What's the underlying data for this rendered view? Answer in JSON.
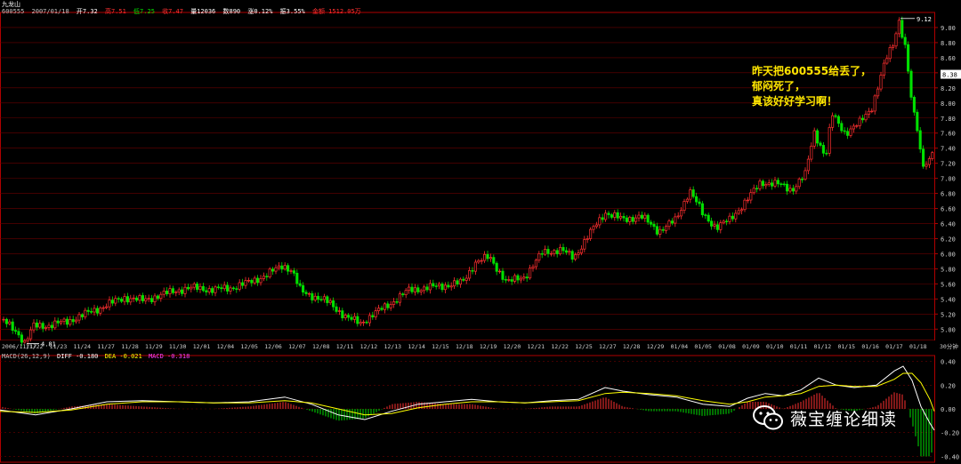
{
  "header": {
    "name": "九龙山",
    "code": "600555",
    "date": "2007/01/18",
    "open": "开7.32",
    "high": "高7.51",
    "low": "低7.25",
    "close": "收7.47",
    "volume": "量12036",
    "count": "数890",
    "change": "涨0.12%",
    "turnover": "振3.55%",
    "amount": "金额 1512.05万"
  },
  "annotation": {
    "line1": "昨天把600555给丢了，",
    "line2": "郁闷死了，",
    "line3": "真该好好学习啊！"
  },
  "macd_label": {
    "params": "MACD(26,12,9)",
    "diff": "DIFF -0.180",
    "dea": "DEA -0.021",
    "macd": "MACD -0.318"
  },
  "watermark": "薇宝缠论细读",
  "colors": {
    "up": "#ff3030",
    "down": "#00e000",
    "grid": "#6a0000",
    "axis": "#b00000",
    "diff_line": "#ffffff",
    "dea_line": "#ffff00",
    "note_text": "#ffe600",
    "current_price_bg": "#ffffff"
  },
  "chart_data": {
    "type": "candlestick",
    "price_axis": {
      "ticks": [
        "9.00",
        "8.80",
        "8.60",
        "8.40",
        "8.20",
        "8.00",
        "7.80",
        "7.60",
        "7.40",
        "7.20",
        "7.00",
        "6.80",
        "6.60",
        "6.40",
        "6.20",
        "6.00",
        "5.80",
        "5.60",
        "5.40",
        "5.20",
        "5.00"
      ],
      "ylim": [
        4.85,
        9.2
      ]
    },
    "current_price": "8.38",
    "max_label": "9.12",
    "min_label": "4.81",
    "x_ticks": [
      "2006/11/17",
      "11/22",
      "11/23",
      "11/24",
      "11/27",
      "11/28",
      "11/29",
      "11/30",
      "12/01",
      "12/04",
      "12/05",
      "12/06",
      "12/07",
      "12/08",
      "12/11",
      "12/12",
      "12/13",
      "12/14",
      "12/15",
      "12/18",
      "12/19",
      "12/20",
      "12/21",
      "12/22",
      "12/25",
      "12/27",
      "12/28",
      "12/29",
      "01/04",
      "01/05",
      "01/08",
      "01/09",
      "01/10",
      "01/11",
      "01/12",
      "01/15",
      "01/16",
      "01/17",
      "01/18"
    ],
    "x_unit": "30分钟",
    "close_path": [
      [
        0,
        5.14
      ],
      [
        10,
        5.05
      ],
      [
        20,
        4.95
      ],
      [
        28,
        4.82
      ],
      [
        38,
        5.04
      ],
      [
        55,
        5.05
      ],
      [
        75,
        5.1
      ],
      [
        100,
        5.22
      ],
      [
        120,
        5.32
      ],
      [
        140,
        5.42
      ],
      [
        160,
        5.38
      ],
      [
        180,
        5.45
      ],
      [
        200,
        5.52
      ],
      [
        220,
        5.55
      ],
      [
        240,
        5.52
      ],
      [
        260,
        5.55
      ],
      [
        280,
        5.62
      ],
      [
        300,
        5.72
      ],
      [
        318,
        5.85
      ],
      [
        328,
        5.78
      ],
      [
        338,
        5.5
      ],
      [
        350,
        5.45
      ],
      [
        370,
        5.35
      ],
      [
        390,
        5.15
      ],
      [
        405,
        5.08
      ],
      [
        420,
        5.2
      ],
      [
        440,
        5.35
      ],
      [
        460,
        5.52
      ],
      [
        480,
        5.55
      ],
      [
        500,
        5.58
      ],
      [
        520,
        5.62
      ],
      [
        535,
        5.9
      ],
      [
        550,
        5.95
      ],
      [
        570,
        5.62
      ],
      [
        590,
        5.7
      ],
      [
        610,
        6.02
      ],
      [
        630,
        6.05
      ],
      [
        645,
        5.95
      ],
      [
        660,
        6.22
      ],
      [
        680,
        6.55
      ],
      [
        700,
        6.45
      ],
      [
        720,
        6.5
      ],
      [
        740,
        6.3
      ],
      [
        760,
        6.45
      ],
      [
        775,
        6.85
      ],
      [
        790,
        6.52
      ],
      [
        805,
        6.35
      ],
      [
        820,
        6.45
      ],
      [
        840,
        6.72
      ],
      [
        855,
        6.95
      ],
      [
        875,
        6.92
      ],
      [
        890,
        6.85
      ],
      [
        905,
        7.05
      ],
      [
        915,
        7.62
      ],
      [
        928,
        7.28
      ],
      [
        935,
        7.85
      ],
      [
        950,
        7.6
      ],
      [
        965,
        7.72
      ],
      [
        980,
        7.95
      ],
      [
        995,
        8.55
      ],
      [
        1005,
        8.82
      ],
      [
        1010,
        9.12
      ],
      [
        1018,
        8.7
      ],
      [
        1025,
        7.95
      ],
      [
        1032,
        7.6
      ],
      [
        1036,
        7.18
      ],
      [
        1045,
        7.25
      ],
      [
        1050,
        7.47
      ]
    ],
    "macd": {
      "ylim": [
        -0.45,
        0.45
      ],
      "ticks": [
        "0.40",
        "0.20",
        "0.00",
        "-0.20",
        "-0.40"
      ],
      "diff_path": [
        [
          0,
          -0.01
        ],
        [
          40,
          -0.05
        ],
        [
          80,
          0.0
        ],
        [
          120,
          0.06
        ],
        [
          160,
          0.07
        ],
        [
          200,
          0.06
        ],
        [
          240,
          0.05
        ],
        [
          280,
          0.06
        ],
        [
          320,
          0.1
        ],
        [
          350,
          0.04
        ],
        [
          380,
          -0.05
        ],
        [
          410,
          -0.09
        ],
        [
          440,
          -0.02
        ],
        [
          470,
          0.04
        ],
        [
          500,
          0.06
        ],
        [
          530,
          0.08
        ],
        [
          560,
          0.06
        ],
        [
          590,
          0.05
        ],
        [
          620,
          0.07
        ],
        [
          650,
          0.08
        ],
        [
          680,
          0.18
        ],
        [
          700,
          0.15
        ],
        [
          730,
          0.12
        ],
        [
          760,
          0.1
        ],
        [
          790,
          0.04
        ],
        [
          820,
          0.02
        ],
        [
          840,
          0.09
        ],
        [
          860,
          0.13
        ],
        [
          880,
          0.11
        ],
        [
          900,
          0.16
        ],
        [
          920,
          0.26
        ],
        [
          940,
          0.2
        ],
        [
          960,
          0.18
        ],
        [
          985,
          0.2
        ],
        [
          1005,
          0.32
        ],
        [
          1015,
          0.36
        ],
        [
          1025,
          0.24
        ],
        [
          1035,
          0.02
        ],
        [
          1045,
          -0.12
        ],
        [
          1050,
          -0.18
        ]
      ],
      "dea_path": [
        [
          0,
          -0.02
        ],
        [
          40,
          -0.03
        ],
        [
          80,
          -0.01
        ],
        [
          120,
          0.04
        ],
        [
          160,
          0.06
        ],
        [
          200,
          0.06
        ],
        [
          240,
          0.05
        ],
        [
          280,
          0.05
        ],
        [
          320,
          0.07
        ],
        [
          350,
          0.05
        ],
        [
          380,
          0.0
        ],
        [
          410,
          -0.05
        ],
        [
          440,
          -0.04
        ],
        [
          470,
          0.01
        ],
        [
          500,
          0.04
        ],
        [
          530,
          0.06
        ],
        [
          560,
          0.06
        ],
        [
          590,
          0.05
        ],
        [
          620,
          0.06
        ],
        [
          650,
          0.07
        ],
        [
          680,
          0.13
        ],
        [
          700,
          0.14
        ],
        [
          730,
          0.13
        ],
        [
          760,
          0.11
        ],
        [
          790,
          0.07
        ],
        [
          820,
          0.04
        ],
        [
          840,
          0.06
        ],
        [
          860,
          0.1
        ],
        [
          880,
          0.11
        ],
        [
          900,
          0.13
        ],
        [
          920,
          0.19
        ],
        [
          940,
          0.2
        ],
        [
          960,
          0.19
        ],
        [
          985,
          0.19
        ],
        [
          1005,
          0.25
        ],
        [
          1015,
          0.3
        ],
        [
          1025,
          0.3
        ],
        [
          1035,
          0.22
        ],
        [
          1045,
          0.08
        ],
        [
          1050,
          -0.02
        ]
      ]
    }
  }
}
